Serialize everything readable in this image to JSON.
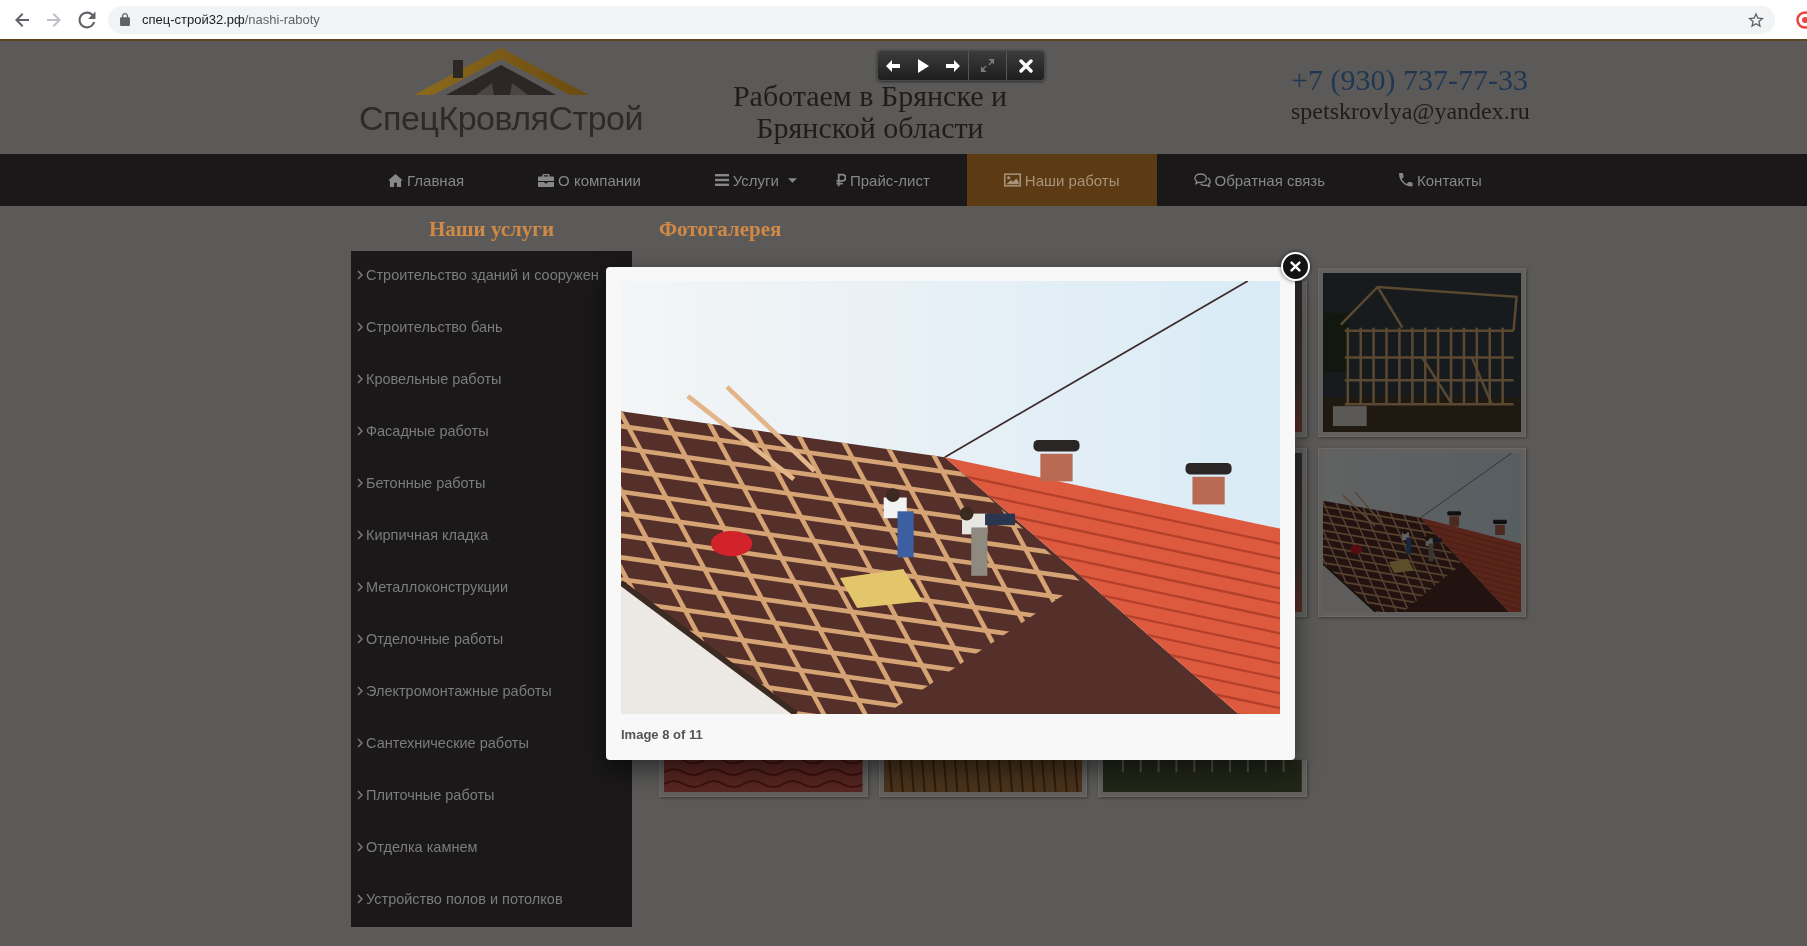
{
  "browser": {
    "url": {
      "host": "спец-строй32.рф",
      "path": "/nashi-raboty"
    }
  },
  "header": {
    "logo": "СпецКровляСтрой",
    "slogan": "Работаем в Брянске и Брянской области",
    "phone": "+7 (930) 737-77-33",
    "email": "spetskrovlya@yandex.ru"
  },
  "nav": {
    "items": [
      {
        "kind": "home",
        "label": "Главная",
        "selected": false,
        "dropdown": false
      },
      {
        "kind": "company",
        "label": "О компании",
        "selected": false,
        "dropdown": false
      },
      {
        "kind": "services",
        "label": "Услуги",
        "selected": false,
        "dropdown": true
      },
      {
        "kind": "prices",
        "label": "Прайс-лист",
        "selected": false,
        "dropdown": false
      },
      {
        "kind": "works",
        "label": "Наши работы",
        "selected": true,
        "dropdown": false
      },
      {
        "kind": "feedback",
        "label": "Обратная связь",
        "selected": false,
        "dropdown": false
      },
      {
        "kind": "contacts",
        "label": "Контакты",
        "selected": false,
        "dropdown": false
      }
    ]
  },
  "sidebar": {
    "title": "Наши услуги",
    "items": [
      "Строительство зданий и сооружен",
      "Строительство бань",
      "Кровельные работы",
      "Фасадные работы",
      "Бетонные работы",
      "Кирпичная кладка",
      "Металлоконструкции",
      "Отделочные работы",
      "Электромонтажные работы",
      "Сантехнические работы",
      "Плиточные работы",
      "Отделка камнем",
      "Устройство полов и потолков"
    ]
  },
  "gallery": {
    "title": "Фотогалерея",
    "thumbnails": [
      {
        "kind": "covered"
      },
      {
        "kind": "covered"
      },
      {
        "kind": "photo"
      },
      {
        "kind": "frame-house"
      },
      {
        "kind": "covered"
      },
      {
        "kind": "covered"
      },
      {
        "kind": "photo"
      },
      {
        "kind": "roof-work"
      },
      {
        "kind": "roof-tiles"
      },
      {
        "kind": "wood-deck"
      },
      {
        "kind": "site"
      }
    ]
  },
  "lightbox": {
    "toolbar": [
      {
        "kind": "prev"
      },
      {
        "kind": "play"
      },
      {
        "kind": "next"
      },
      {
        "kind": "fullscreen"
      },
      {
        "kind": "close"
      }
    ],
    "caption": "Image 8 of 11"
  }
}
